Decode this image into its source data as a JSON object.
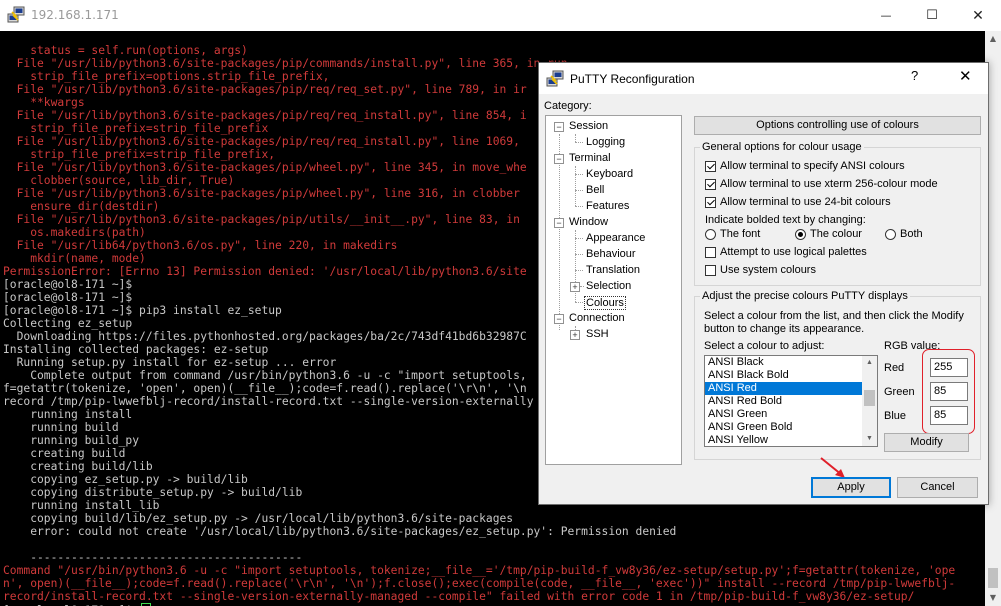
{
  "main_window": {
    "title": "192.168.1.171",
    "controls": {
      "minimize": "—",
      "maximize": "☐",
      "close": "✕"
    }
  },
  "terminal": {
    "lines": [
      {
        "text": "    status = self.run(options, args)",
        "color": "red"
      },
      {
        "text": "  File \"/usr/lib/python3.6/site-packages/pip/commands/install.py\", line 365, in run",
        "color": "red"
      },
      {
        "text": "    strip_file_prefix=options.strip_file_prefix,",
        "color": "red"
      },
      {
        "text": "  File \"/usr/lib/python3.6/site-packages/pip/req/req_set.py\", line 789, in ir",
        "color": "red"
      },
      {
        "text": "    **kwargs",
        "color": "red"
      },
      {
        "text": "  File \"/usr/lib/python3.6/site-packages/pip/req/req_install.py\", line 854, i",
        "color": "red"
      },
      {
        "text": "    strip_file_prefix=strip_file_prefix",
        "color": "red"
      },
      {
        "text": "  File \"/usr/lib/python3.6/site-packages/pip/req/req_install.py\", line 1069,",
        "color": "red"
      },
      {
        "text": "    strip_file_prefix=strip_file_prefix,",
        "color": "red"
      },
      {
        "text": "  File \"/usr/lib/python3.6/site-packages/pip/wheel.py\", line 345, in move_whe",
        "color": "red"
      },
      {
        "text": "    clobber(source, lib_dir, True)",
        "color": "red"
      },
      {
        "text": "  File \"/usr/lib/python3.6/site-packages/pip/wheel.py\", line 316, in clobber",
        "color": "red"
      },
      {
        "text": "    ensure_dir(destdir)",
        "color": "red"
      },
      {
        "text": "  File \"/usr/lib/python3.6/site-packages/pip/utils/__init__.py\", line 83, in",
        "color": "red"
      },
      {
        "text": "    os.makedirs(path)",
        "color": "red"
      },
      {
        "text": "  File \"/usr/lib64/python3.6/os.py\", line 220, in makedirs",
        "color": "red"
      },
      {
        "text": "    mkdir(name, mode)",
        "color": "red"
      },
      {
        "text": "PermissionError: [Errno 13] Permission denied: '/usr/local/lib/python3.6/site",
        "color": "red"
      },
      {
        "text": "[oracle@ol8-171 ~]$",
        "color": "gray"
      },
      {
        "text": "[oracle@ol8-171 ~]$",
        "color": "gray"
      },
      {
        "text": "[oracle@ol8-171 ~]$ pip3 install ez_setup",
        "color": "gray"
      },
      {
        "text": "Collecting ez_setup",
        "color": "gray"
      },
      {
        "text": "  Downloading https://files.pythonhosted.org/packages/ba/2c/743df41bd6b32987C",
        "color": "gray"
      },
      {
        "text": "Installing collected packages: ez-setup",
        "color": "gray"
      },
      {
        "text": "  Running setup.py install for ez-setup ... error",
        "color": "gray"
      },
      {
        "text": "    Complete output from command /usr/bin/python3.6 -u -c \"import setuptools,",
        "color": "gray"
      },
      {
        "text": "f=getattr(tokenize, 'open', open)(__file__);code=f.read().replace('\\r\\n', '\\n",
        "color": "gray"
      },
      {
        "text": "record /tmp/pip-lwwefblj-record/install-record.txt --single-version-externally",
        "color": "gray"
      },
      {
        "text": "    running install",
        "color": "gray"
      },
      {
        "text": "    running build",
        "color": "gray"
      },
      {
        "text": "    running build_py",
        "color": "gray"
      },
      {
        "text": "    creating build",
        "color": "gray"
      },
      {
        "text": "    creating build/lib",
        "color": "gray"
      },
      {
        "text": "    copying ez_setup.py -> build/lib",
        "color": "gray"
      },
      {
        "text": "    copying distribute_setup.py -> build/lib",
        "color": "gray"
      },
      {
        "text": "    running install_lib",
        "color": "gray"
      },
      {
        "text": "    copying build/lib/ez_setup.py -> /usr/local/lib/python3.6/site-packages",
        "color": "gray"
      },
      {
        "text": "    error: could not create '/usr/local/lib/python3.6/site-packages/ez_setup.py': Permission denied",
        "color": "gray"
      },
      {
        "text": "",
        "color": "gray"
      },
      {
        "text": "    ----------------------------------------",
        "color": "gray"
      },
      {
        "text": "Command \"/usr/bin/python3.6 -u -c \"import setuptools, tokenize;__file__='/tmp/pip-build-f_vw8y36/ez-setup/setup.py';f=getattr(tokenize, 'ope",
        "color": "red"
      },
      {
        "text": "n', open)(__file__);code=f.read().replace('\\r\\n', '\\n');f.close();exec(compile(code, __file__, 'exec'))\" install --record /tmp/pip-lwwefblj-",
        "color": "red"
      },
      {
        "text": "record/install-record.txt --single-version-externally-managed --compile\" failed with error code 1 in /tmp/pip-build-f_vw8y36/ez-setup/",
        "color": "red"
      },
      {
        "text": "[oracle@ol8-171 ~]$ ",
        "color": "gray",
        "cursor": true
      }
    ]
  },
  "dialog": {
    "title": "PuTTY Reconfiguration",
    "help_glyph": "?",
    "close_glyph": "✕",
    "category_label": "Category:",
    "tree": {
      "session": "Session",
      "logging": "Logging",
      "terminal": "Terminal",
      "keyboard": "Keyboard",
      "bell": "Bell",
      "features": "Features",
      "window": "Window",
      "appearance": "Appearance",
      "behaviour": "Behaviour",
      "translation": "Translation",
      "selection": "Selection",
      "colours": "Colours",
      "connection": "Connection",
      "ssh": "SSH",
      "expander_minus": "−",
      "expander_plus": "+"
    },
    "panel_header": "Options controlling use of colours",
    "general": {
      "title": "General options for colour usage",
      "ansi": {
        "label": "Allow terminal to specify ANSI colours",
        "checked": true
      },
      "xterm256": {
        "label": "Allow terminal to use xterm 256-colour mode",
        "checked": true
      },
      "truecolour": {
        "label": "Allow terminal to use 24-bit colours",
        "checked": true
      },
      "bold_label": "Indicate bolded text by changing:",
      "bold_options": {
        "font": "The font",
        "colour": "The colour",
        "both": "Both"
      },
      "bold_selected": "colour",
      "logical_palettes": {
        "label": "Attempt to use logical palettes",
        "checked": false
      },
      "system_colours": {
        "label": "Use system colours",
        "checked": false
      }
    },
    "adjust": {
      "title": "Adjust the precise colours PuTTY displays",
      "instructions_line1": "Select a colour from the list, and then click the Modify",
      "instructions_line2": "button to change its appearance.",
      "list_label": "Select a colour to adjust:",
      "colours": [
        "ANSI Black",
        "ANSI Black Bold",
        "ANSI Red",
        "ANSI Red Bold",
        "ANSI Green",
        "ANSI Green Bold",
        "ANSI Yellow"
      ],
      "selected_colour": "ANSI Red",
      "rgb_label": "RGB value:",
      "red_label": "Red",
      "green_label": "Green",
      "blue_label": "Blue",
      "red_value": "255",
      "green_value": "85",
      "blue_value": "85",
      "modify_label": "Modify"
    },
    "apply_label": "Apply",
    "cancel_label": "Cancel"
  },
  "colors": {
    "terminal_bg": "#000000",
    "terminal_red": "#d03a3a",
    "terminal_gray": "#c8c8c8",
    "cursor_green": "#3ddc4f",
    "selection_blue": "#0078d7",
    "annotation_red": "#e0202a"
  },
  "icons": {
    "app": "putty-icon",
    "annotation": "red-arrow-icon"
  }
}
